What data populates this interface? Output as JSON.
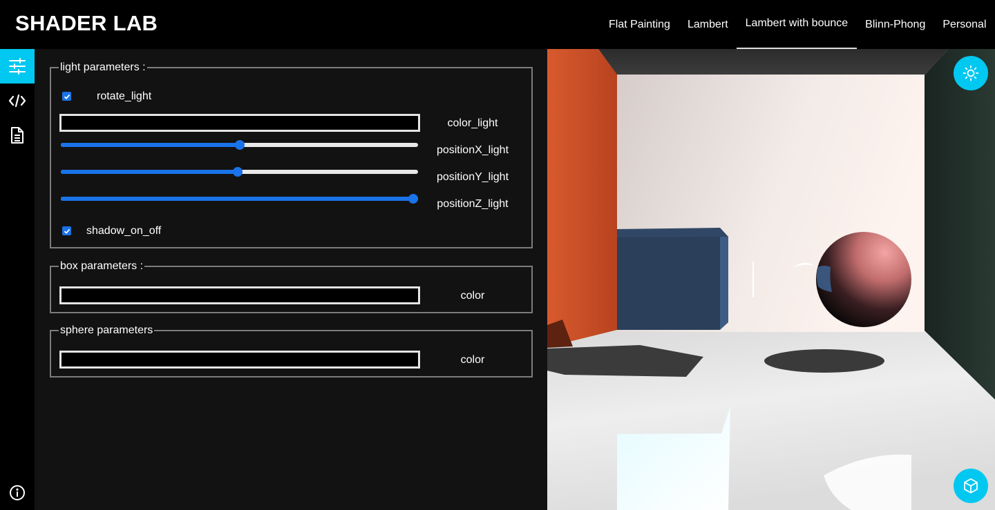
{
  "app": {
    "title": "SHADER LAB"
  },
  "nav": {
    "tabs": [
      {
        "label": "Flat Painting"
      },
      {
        "label": "Lambert"
      },
      {
        "label": "Lambert with bounce"
      },
      {
        "label": "Blinn-Phong"
      },
      {
        "label": "Personal"
      }
    ],
    "active_tab": "Lambert with bounce"
  },
  "sidebar": {
    "items": [
      {
        "icon": "sliders-icon",
        "active": true
      },
      {
        "icon": "code-icon",
        "active": false
      },
      {
        "icon": "document-icon",
        "active": false
      }
    ],
    "footer_icon": "info-icon"
  },
  "light_parameters": {
    "legend": "light parameters :",
    "rotate_light": {
      "label": "rotate_light",
      "checked": true
    },
    "color_light": {
      "label": "color_light",
      "value": "#000000"
    },
    "positionX_light": {
      "label": "positionX_light",
      "value": 0.5
    },
    "positionY_light": {
      "label": "positionY_light",
      "value": 0.495
    },
    "positionZ_light": {
      "label": "positionZ_light",
      "value": 1.0
    },
    "shadow_on_off": {
      "label": "shadow_on_off",
      "checked": true
    }
  },
  "box_parameters": {
    "legend": "box parameters :",
    "color": {
      "label": "color",
      "value": "#000000"
    }
  },
  "sphere_parameters": {
    "legend": "sphere parameters",
    "color": {
      "label": "color",
      "value": "#000000"
    }
  },
  "viewport": {
    "light_button_icon": "sun-icon",
    "camera_button_icon": "cube-icon"
  },
  "colors": {
    "accent": "#00c8f0",
    "slider": "#1a73e8",
    "panel_bg": "#121212",
    "left_wall": "#d2542c",
    "right_wall": "#24302b",
    "box": "#2b3f5a",
    "sphere": "#e88a8a"
  }
}
